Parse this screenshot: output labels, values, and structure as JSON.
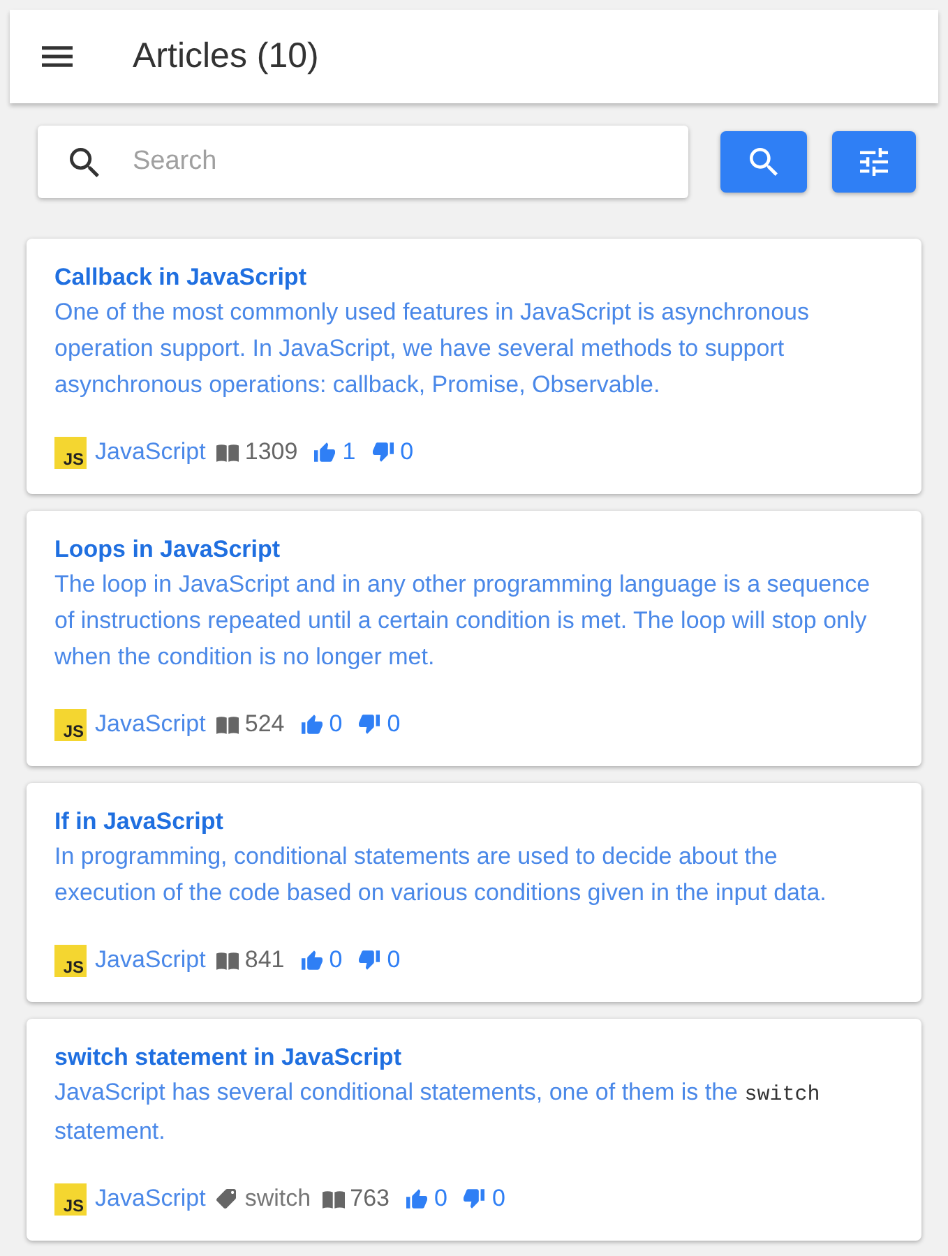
{
  "app_bar": {
    "title": "Articles (10)"
  },
  "search": {
    "placeholder": "Search"
  },
  "articles": [
    {
      "title": "Callback in JavaScript",
      "description": [
        {
          "kind": "text",
          "text": "One of the most commonly used features in JavaScript is asynchronous operation support. In JavaScript, we have several methods to support asynchronous operations: callback, Promise, Observable."
        }
      ],
      "category": {
        "logo": "JS",
        "name": "JavaScript"
      },
      "views": "1309",
      "likes": "1",
      "dislikes": "0"
    },
    {
      "title": "Loops in JavaScript",
      "description": [
        {
          "kind": "text",
          "text": "The loop in JavaScript and in any other programming language is a sequence of instructions repeated until a certain condition is met. The loop will stop only when the condition is no longer met."
        }
      ],
      "category": {
        "logo": "JS",
        "name": "JavaScript"
      },
      "views": "524",
      "likes": "0",
      "dislikes": "0"
    },
    {
      "title": "If in JavaScript",
      "description": [
        {
          "kind": "text",
          "text": "In programming, conditional statements are used to decide about the execution of the code based on various conditions given in the input data."
        }
      ],
      "category": {
        "logo": "JS",
        "name": "JavaScript"
      },
      "views": "841",
      "likes": "0",
      "dislikes": "0"
    },
    {
      "title": "switch statement in JavaScript",
      "description": [
        {
          "kind": "text",
          "text": "JavaScript has several conditional statements, one of them is the "
        },
        {
          "kind": "code",
          "text": "switch"
        },
        {
          "kind": "text",
          "text": " statement."
        }
      ],
      "category": {
        "logo": "JS",
        "name": "JavaScript"
      },
      "tags": [
        "switch"
      ],
      "views": "763",
      "likes": "0",
      "dislikes": "0"
    }
  ]
}
